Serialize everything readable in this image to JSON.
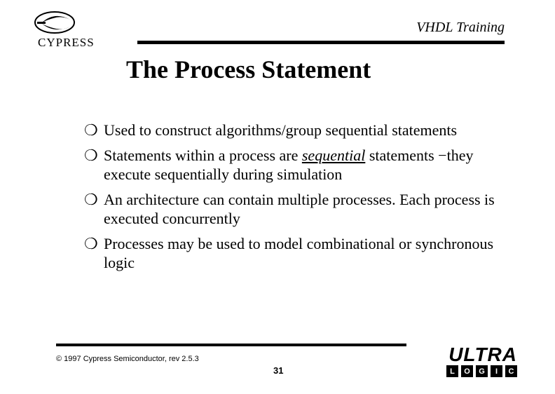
{
  "header": {
    "brand": "CYPRESS",
    "doc_title": "VHDL Training"
  },
  "title": "The Process Statement",
  "bullets": [
    {
      "prefix": "Used to construct algorithms/group sequential statements",
      "emph": "",
      "suffix": ""
    },
    {
      "prefix": "Statements within a process are ",
      "emph": "sequential",
      "suffix": " statements −they execute sequentially during simulation"
    },
    {
      "prefix": "An architecture can contain multiple processes.  Each process is executed concurrently",
      "emph": "",
      "suffix": ""
    },
    {
      "prefix": "Processes may be used to model combinational or synchronous logic",
      "emph": "",
      "suffix": ""
    }
  ],
  "footer": {
    "copyright": "© 1997 Cypress Semiconductor, rev 2.5.3",
    "page": "31",
    "logo_main": "ULTRA",
    "logo_letters": [
      "L",
      "O",
      "G",
      "I",
      "C"
    ]
  }
}
